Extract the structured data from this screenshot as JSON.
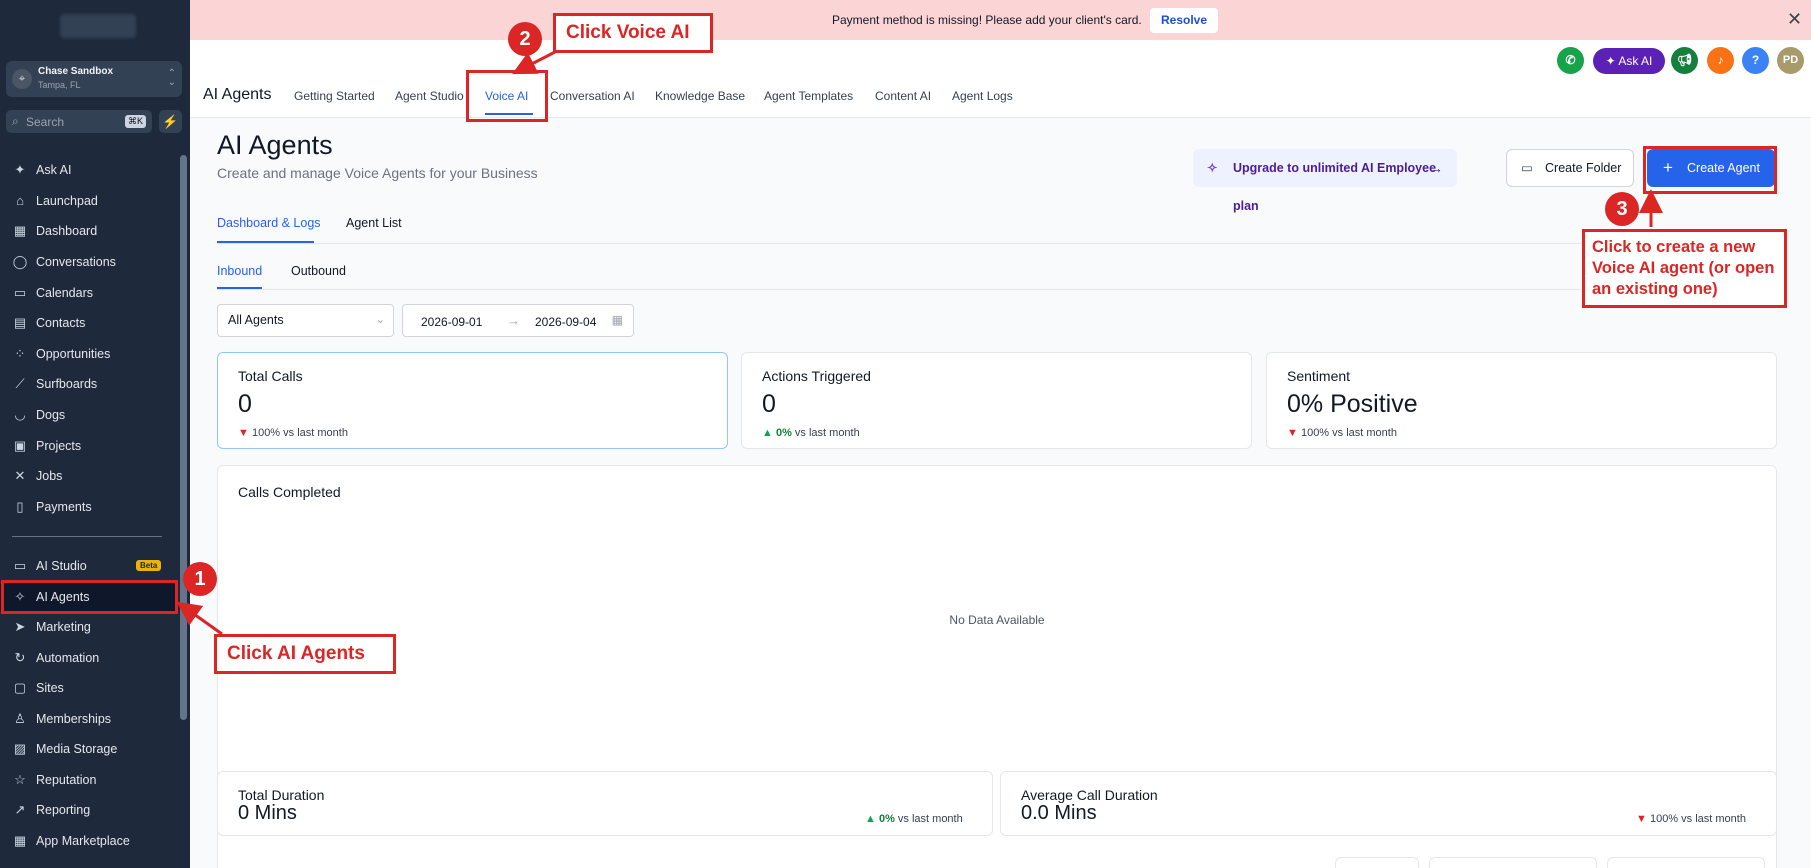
{
  "sidebar": {
    "account_name": "Chase Sandbox",
    "account_location": "Tampa, FL",
    "search_placeholder": "Search",
    "search_shortcut": "⌘K",
    "items": [
      {
        "label": "Ask AI",
        "icon": "sparkle-icon"
      },
      {
        "label": "Launchpad",
        "icon": "rocket-icon"
      },
      {
        "label": "Dashboard",
        "icon": "grid-icon"
      },
      {
        "label": "Conversations",
        "icon": "chat-bubble-icon"
      },
      {
        "label": "Calendars",
        "icon": "calendar-icon"
      },
      {
        "label": "Contacts",
        "icon": "address-book-icon"
      },
      {
        "label": "Opportunities",
        "icon": "network-icon"
      },
      {
        "label": "Surfboards",
        "icon": "surfboard-icon"
      },
      {
        "label": "Dogs",
        "icon": "dog-icon"
      },
      {
        "label": "Projects",
        "icon": "clipboard-icon"
      },
      {
        "label": "Jobs",
        "icon": "tools-icon"
      },
      {
        "label": "Payments",
        "icon": "receipt-icon"
      }
    ],
    "items2": [
      {
        "label": "AI Studio",
        "icon": "ai-studio-icon",
        "badge": "Beta"
      },
      {
        "label": "AI Agents",
        "icon": "ai-agents-icon",
        "active": true
      },
      {
        "label": "Marketing",
        "icon": "send-icon"
      },
      {
        "label": "Automation",
        "icon": "automation-icon"
      },
      {
        "label": "Sites",
        "icon": "sites-icon"
      },
      {
        "label": "Memberships",
        "icon": "membership-icon"
      },
      {
        "label": "Media Storage",
        "icon": "image-icon"
      },
      {
        "label": "Reputation",
        "icon": "star-icon"
      },
      {
        "label": "Reporting",
        "icon": "trend-icon"
      },
      {
        "label": "App Marketplace",
        "icon": "apps-icon"
      }
    ]
  },
  "banner": {
    "message": "Payment method is missing! Please add your client's card.",
    "resolve_label": "Resolve"
  },
  "header": {
    "title": "AI Agents",
    "tabs": [
      "Getting Started",
      "Agent Studio",
      "Voice AI",
      "Conversation AI",
      "Knowledge Base",
      "Agent Templates",
      "Content AI",
      "Agent Logs"
    ],
    "ask_ai_label": "Ask AI",
    "avatar_initials": "PD",
    "help_label": "?"
  },
  "page": {
    "title": "AI Agents",
    "subtitle": "Create and manage Voice Agents for your Business",
    "upgrade_label": "Upgrade to unlimited AI Employee plan",
    "create_folder_label": "Create Folder",
    "create_agent_label": "Create Agent",
    "subtabs": [
      "Dashboard & Logs",
      "Agent List"
    ],
    "direction_tabs": [
      "Inbound",
      "Outbound"
    ],
    "agent_filter": "All Agents",
    "date_start": "2026-09-01",
    "date_end": "2026-09-04"
  },
  "stats": {
    "total_calls": {
      "title": "Total Calls",
      "value": "0",
      "delta": "100%",
      "delta_suffix": "vs last month"
    },
    "actions_triggered": {
      "title": "Actions Triggered",
      "value": "0",
      "delta": "0%",
      "delta_suffix": "vs last month"
    },
    "sentiment": {
      "title": "Sentiment",
      "value": "0% Positive",
      "delta": "100%",
      "delta_suffix": "vs last month"
    },
    "calls_completed": {
      "title": "Calls Completed",
      "empty": "No Data Available"
    },
    "total_duration": {
      "title": "Total Duration",
      "value": "0 Mins",
      "delta": "0%",
      "delta_suffix": "vs last month"
    },
    "avg_duration": {
      "title": "Average Call Duration",
      "value": "0.0 Mins",
      "delta": "100%",
      "delta_suffix": "vs last month"
    }
  },
  "annotations": {
    "step1_num": "1",
    "step1_label": "Click AI Agents",
    "step2_num": "2",
    "step2_label": "Click Voice AI",
    "step3_num": "3",
    "step3_label_line1": "Click to create a new",
    "step3_label_line2": "Voice AI agent (or open",
    "step3_label_line3": "an existing one)"
  },
  "colors": {
    "accent": "#2563eb",
    "annotation": "#dc2626",
    "sidebar_bg": "#1e293b",
    "banner_bg": "#fbd5d5"
  }
}
